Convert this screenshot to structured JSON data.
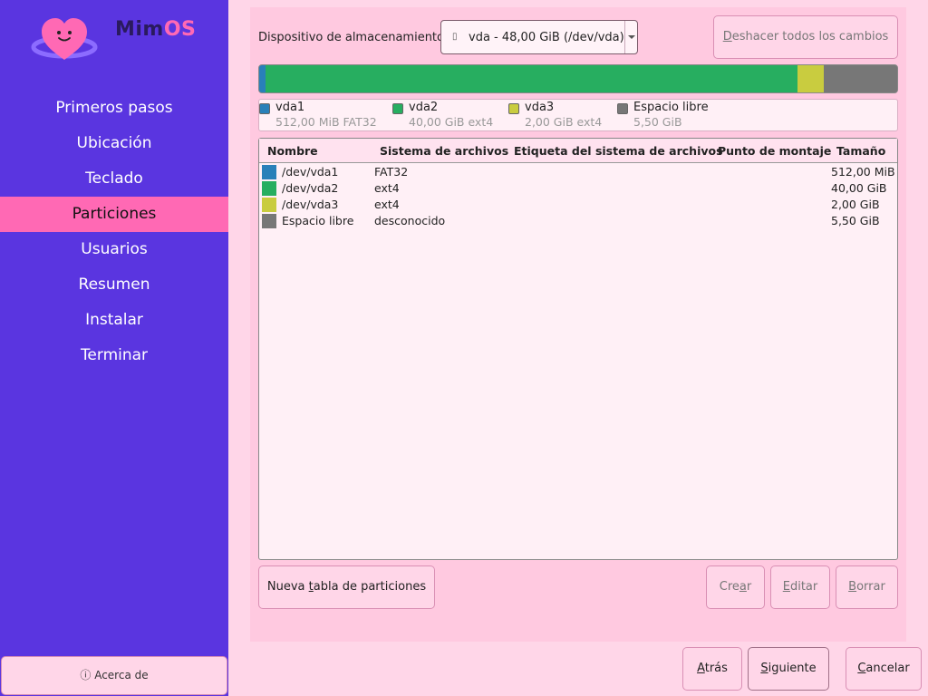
{
  "app": {
    "brand_part1": "Mim",
    "brand_part2": "OS",
    "accent": "#ff69b4",
    "sidebar_color": "#5a35e0"
  },
  "sidebar": {
    "items": [
      {
        "label": "Primeros pasos",
        "active": false
      },
      {
        "label": "Ubicación",
        "active": false
      },
      {
        "label": "Teclado",
        "active": false
      },
      {
        "label": "Particiones",
        "active": true
      },
      {
        "label": "Usuarios",
        "active": false
      },
      {
        "label": "Resumen",
        "active": false
      },
      {
        "label": "Instalar",
        "active": false
      },
      {
        "label": "Terminar",
        "active": false
      }
    ],
    "about": {
      "icon": "info-icon",
      "glyph": "ⓘ",
      "label": "Acerca de"
    }
  },
  "storage": {
    "label": "Dispositivo de almacenamiento:",
    "device_icon": "disk-icon",
    "device_value": "vda - 48,00 GiB (/dev/vda)",
    "revert_first": "D",
    "revert_rest": "eshacer todos los cambios"
  },
  "partitions": [
    {
      "name": "vda1",
      "path": "/dev/vda1",
      "filesystem": "FAT32",
      "label": "",
      "mount": "",
      "size": "512,00 MiB",
      "legend_detail": "512,00 MiB FAT32",
      "color": "#2980b9",
      "fraction": 0.0104
    },
    {
      "name": "vda2",
      "path": "/dev/vda2",
      "filesystem": "ext4",
      "label": "",
      "mount": "",
      "size": "40,00 GiB",
      "legend_detail": "40,00 GiB ext4",
      "color": "#27ae60",
      "fraction": 0.8333
    },
    {
      "name": "vda3",
      "path": "/dev/vda3",
      "filesystem": "ext4",
      "label": "",
      "mount": "",
      "size": "2,00 GiB",
      "legend_detail": "2,00 GiB ext4",
      "color": "#c9cc3f",
      "fraction": 0.0417
    },
    {
      "name": "Espacio libre",
      "path": "Espacio libre",
      "filesystem": "desconocido",
      "label": "",
      "mount": "",
      "size": "5,50 GiB",
      "legend_detail": "5,50 GiB",
      "color": "#777777",
      "fraction": 0.1146
    }
  ],
  "table": {
    "headers": [
      "Nombre",
      "Sistema de archivos",
      "Etiqueta del sistema de archivos",
      "Punto de montaje",
      "Tamaño"
    ]
  },
  "actions": {
    "new_table": {
      "pre": "Nueva ",
      "key": "t",
      "post": "abla de particiones"
    },
    "create": {
      "pre": "Cre",
      "key": "a",
      "post": "r"
    },
    "edit": {
      "pre": "",
      "key": "E",
      "post": "ditar"
    },
    "delete": {
      "pre": "",
      "key": "B",
      "post": "orrar"
    }
  },
  "footer": {
    "back": {
      "key": "A",
      "post": "trás"
    },
    "next": {
      "key": "S",
      "post": "iguiente"
    },
    "cancel": {
      "key": "C",
      "post": "ancelar"
    }
  }
}
